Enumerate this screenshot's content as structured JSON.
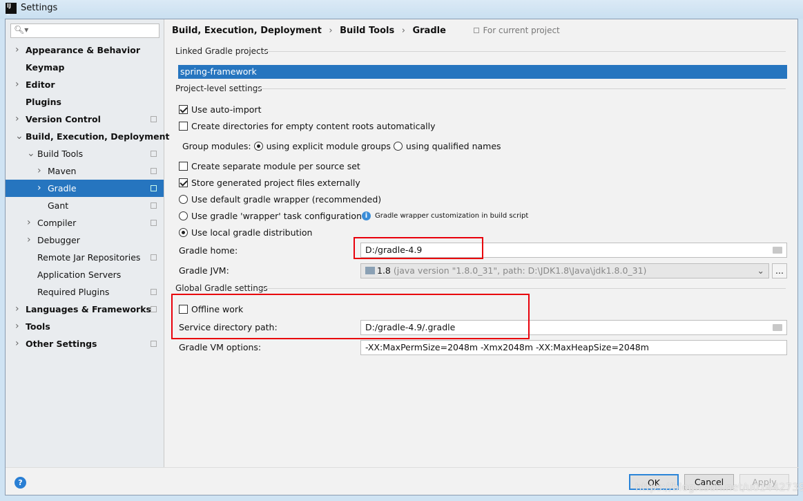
{
  "window": {
    "title": "Settings",
    "icon": "intellij-icon"
  },
  "search": {
    "placeholder": ""
  },
  "sidebar": {
    "items": [
      {
        "label": "Appearance & Behavior",
        "bold": true,
        "arrow": "right",
        "level": 0
      },
      {
        "label": "Keymap",
        "bold": true,
        "level": 0
      },
      {
        "label": "Editor",
        "bold": true,
        "arrow": "right",
        "level": 0
      },
      {
        "label": "Plugins",
        "bold": true,
        "level": 0
      },
      {
        "label": "Version Control",
        "bold": true,
        "arrow": "right",
        "level": 0,
        "copy": true
      },
      {
        "label": "Build, Execution, Deployment",
        "bold": true,
        "arrow": "down",
        "level": 0
      },
      {
        "label": "Build Tools",
        "arrow": "down",
        "level": 1,
        "copy": true
      },
      {
        "label": "Maven",
        "arrow": "right",
        "level": 2,
        "copy": true
      },
      {
        "label": "Gradle",
        "arrow": "right",
        "level": 2,
        "copy": true,
        "selected": true
      },
      {
        "label": "Gant",
        "level": 2,
        "copy": true
      },
      {
        "label": "Compiler",
        "arrow": "right",
        "level": 1,
        "copy": true
      },
      {
        "label": "Debugger",
        "arrow": "right",
        "level": 1
      },
      {
        "label": "Remote Jar Repositories",
        "level": 1,
        "copy": true
      },
      {
        "label": "Application Servers",
        "level": 1
      },
      {
        "label": "Required Plugins",
        "level": 1,
        "copy": true
      },
      {
        "label": "Languages & Frameworks",
        "bold": true,
        "arrow": "right",
        "level": 0,
        "copy": true
      },
      {
        "label": "Tools",
        "bold": true,
        "arrow": "right",
        "level": 0
      },
      {
        "label": "Other Settings",
        "bold": true,
        "arrow": "right",
        "level": 0,
        "copy": true
      }
    ]
  },
  "breadcrumb": {
    "items": [
      "Build, Execution, Deployment",
      "Build Tools",
      "Gradle"
    ],
    "scope": "For current project"
  },
  "linked": {
    "title": "Linked Gradle projects",
    "project": "spring-framework"
  },
  "project_settings": {
    "title": "Project-level settings",
    "auto_import": {
      "label": "Use auto-import",
      "checked": true
    },
    "create_dirs": {
      "label": "Create directories for empty content roots automatically",
      "checked": false
    },
    "group_modules": {
      "label": "Group modules:",
      "opt1": "using explicit module groups",
      "opt2": "using qualified names",
      "selected": 1
    },
    "separate_module": {
      "label": "Create separate module per source set",
      "checked": false
    },
    "store_external": {
      "label": "Store generated project files externally",
      "checked": true
    },
    "dist_default": "Use default gradle wrapper (recommended)",
    "dist_wrapper": "Use gradle 'wrapper' task configuration",
    "wrapper_info": "Gradle wrapper customization in build script",
    "dist_local": "Use local gradle distribution",
    "dist_selected": 3,
    "gradle_home_label": "Gradle home:",
    "gradle_home": "D:/gradle-4.9",
    "gradle_jvm_label": "Gradle JVM:",
    "gradle_jvm_version": "1.8",
    "gradle_jvm_detail": "(java version \"1.8.0_31\", path: D:\\JDK1.8\\Java\\jdk1.8.0_31)",
    "jvm_more": "..."
  },
  "global": {
    "title": "Global Gradle settings",
    "offline": {
      "label": "Offline work",
      "checked": false
    },
    "service_dir_label": "Service directory path:",
    "service_dir": "D:/gradle-4.9/.gradle",
    "vm_options_label": "Gradle VM options:",
    "vm_options": "-XX:MaxPermSize=2048m -Xmx2048m -XX:MaxHeapSize=2048m"
  },
  "footer": {
    "ok": "OK",
    "cancel": "Cancel",
    "apply": "Apply",
    "help": "?"
  },
  "watermark": "https://blog.csdn.net/u014427391",
  "colors": {
    "selection": "#2675bf",
    "highlight": "#e8000b"
  }
}
